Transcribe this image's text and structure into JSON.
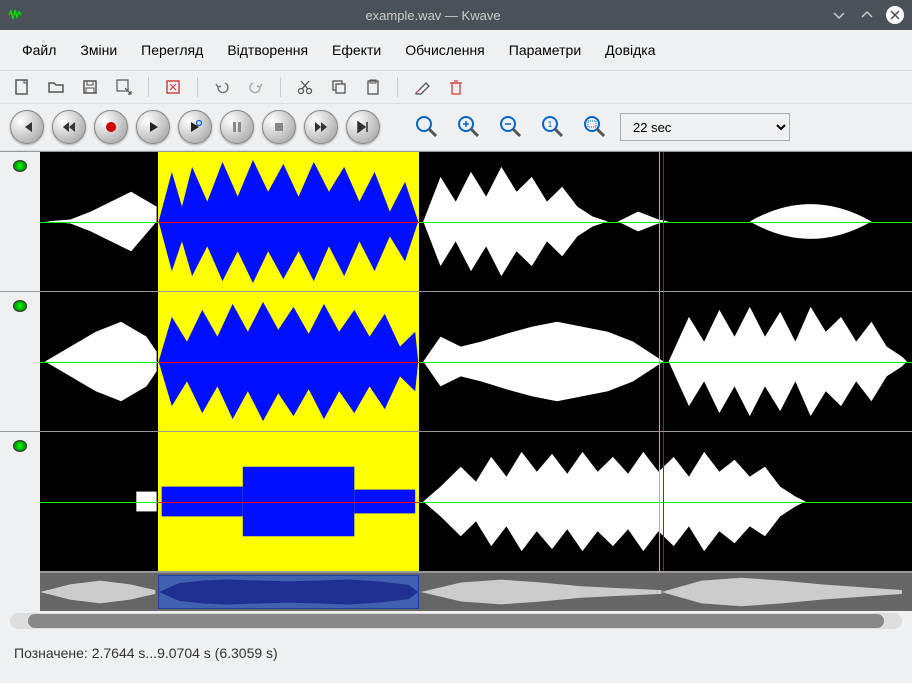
{
  "title": "example.wav — Kwave",
  "menu": {
    "file": "Файл",
    "edit": "Зміни",
    "view": "Перегляд",
    "play": "Відтворення",
    "effects": "Ефекти",
    "calc": "Обчислення",
    "prefs": "Параметри",
    "help": "Довідка"
  },
  "zoom": {
    "value": "22 sec"
  },
  "status": "Позначене: 2.7644 s...9.0704 s (6.3059 s)",
  "icons": {
    "new": "new",
    "open": "open",
    "save": "save",
    "saveas": "saveas",
    "close": "close",
    "undo": "undo",
    "redo": "redo",
    "cut": "cut",
    "copy": "copy",
    "paste": "paste",
    "erase": "erase",
    "delete": "delete"
  }
}
